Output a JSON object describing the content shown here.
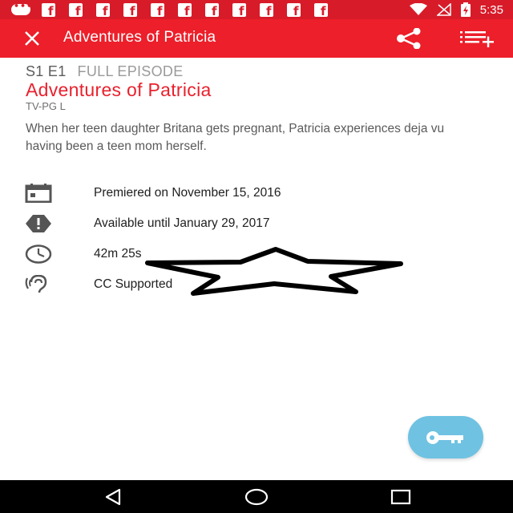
{
  "status_bar": {
    "time": "5:35",
    "notification_icons": [
      "message-icon",
      "facebook-icon",
      "facebook-icon",
      "facebook-icon",
      "facebook-icon",
      "facebook-icon",
      "facebook-icon",
      "facebook-icon",
      "facebook-icon",
      "facebook-icon",
      "facebook-icon",
      "facebook-icon"
    ],
    "system_icons": [
      "wifi-icon",
      "signal-off-icon",
      "battery-charging-icon"
    ]
  },
  "app_bar": {
    "title": "Adventures of Patricia",
    "background": "#ec1f2a"
  },
  "episode": {
    "number": "S1 E1",
    "type": "FULL EPISODE",
    "title": "Adventures of Patricia",
    "rating": "TV-PG L",
    "description": "When her teen daughter Britana gets pregnant, Patricia experiences deja vu having been a teen mom herself."
  },
  "details": [
    {
      "icon": "calendar-icon",
      "text": "Premiered on November 15, 2016"
    },
    {
      "icon": "alert-icon",
      "text": "Available until January 29, 2017"
    },
    {
      "icon": "clock-icon",
      "text": "42m 25s"
    },
    {
      "icon": "hearing-icon",
      "text": "CC Supported"
    }
  ],
  "fab": {
    "icon": "key-icon",
    "color": "#6fc2e2"
  },
  "nav_bar": {
    "buttons": [
      "back-icon",
      "home-icon",
      "recents-icon"
    ]
  },
  "colors": {
    "accent": "#e8212d",
    "status_bar": "#d81b29"
  }
}
